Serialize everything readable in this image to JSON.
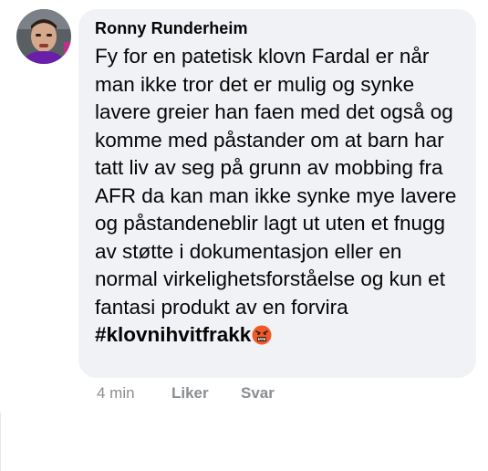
{
  "comment": {
    "author": "Ronny Runderheim",
    "text": "Fy for en patetisk klovn Fardal er når man ikke tror det er mulig og synke lavere greier han faen med det også og komme med påstander om at barn har tatt liv av seg på grunn av mobbing fra AFR da kan man ikke synke mye lavere og påstandeneblir lagt ut uten et fnugg av støtte i dokumentasjon eller en normal virkelighetsforståelse og kun et fantasi produkt av en forvira",
    "hashtag": "#klovnihvitfrakk",
    "emoji": "angry-face-with-symbols-icon",
    "time": "4 min",
    "like_label": "Liker",
    "reply_label": "Svar"
  },
  "colors": {
    "bubble": "#f0f2f5",
    "text": "#050505",
    "meta": "#8a8d91",
    "emoji": "#f05a28"
  }
}
